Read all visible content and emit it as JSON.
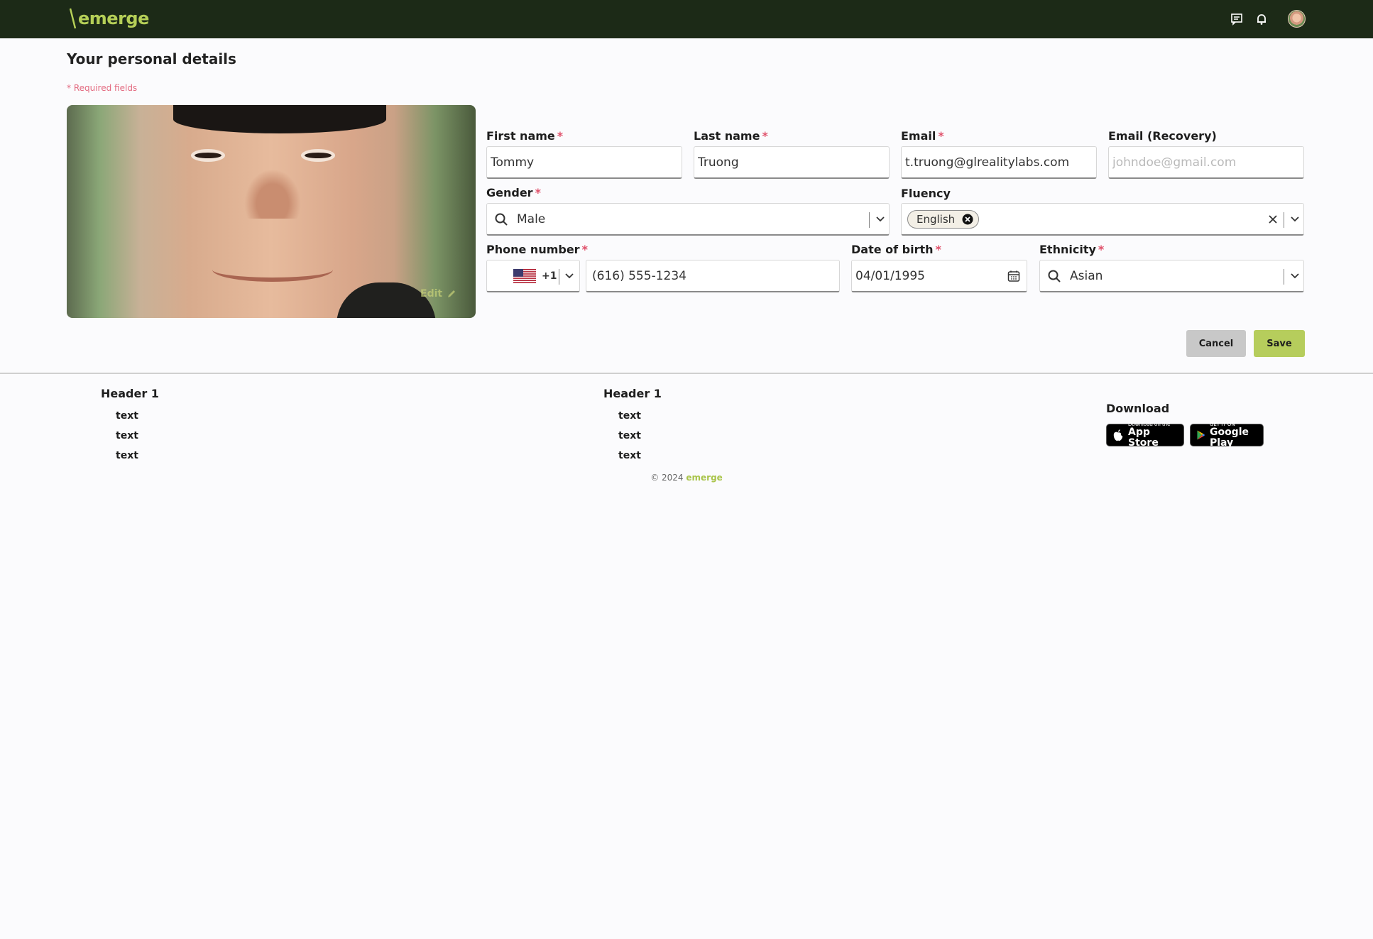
{
  "header": {
    "logo_text": "emerge",
    "icons": [
      "chat-icon",
      "bell-icon"
    ]
  },
  "page": {
    "title": "Your personal details",
    "required_note": "* Required fields",
    "photo_edit_label": "Edit"
  },
  "form": {
    "first_name": {
      "label": "First name",
      "value": "Tommy",
      "required": "*"
    },
    "last_name": {
      "label": "Last name",
      "value": "Truong",
      "required": "*"
    },
    "email": {
      "label": "Email",
      "value": "t.truong@glrealitylabs.com",
      "required": "*"
    },
    "email_recovery": {
      "label": "Email (Recovery)",
      "placeholder": "johndoe@gmail.com"
    },
    "gender": {
      "label": "Gender",
      "value": "Male",
      "required": "*"
    },
    "fluency": {
      "label": "Fluency",
      "chips": [
        "English"
      ]
    },
    "phone": {
      "label": "Phone number",
      "country_code": "+1",
      "value": "(616) 555-1234",
      "required": "*"
    },
    "dob": {
      "label": "Date of birth",
      "value": "04/01/1995",
      "required": "*"
    },
    "ethnicity": {
      "label": "Ethnicity",
      "value": "Asian",
      "required": "*"
    }
  },
  "actions": {
    "cancel": "Cancel",
    "save": "Save"
  },
  "footer": {
    "columns": [
      {
        "header": "Header 1",
        "links": [
          "text",
          "text",
          "text"
        ]
      },
      {
        "header": "Header 1",
        "links": [
          "text",
          "text",
          "text"
        ]
      }
    ],
    "download": {
      "header": "Download",
      "app_store": {
        "small": "Download on the",
        "big": "App Store"
      },
      "google_play": {
        "small": "GET IT ON",
        "big": "Google Play"
      }
    },
    "copyright_prefix": "© 2024",
    "copyright_brand": "emerge"
  },
  "colors": {
    "topbar": "#1c2a17",
    "brand": "#b5cf57",
    "save_button": "#b6cd5c",
    "required": "#e0506a"
  }
}
